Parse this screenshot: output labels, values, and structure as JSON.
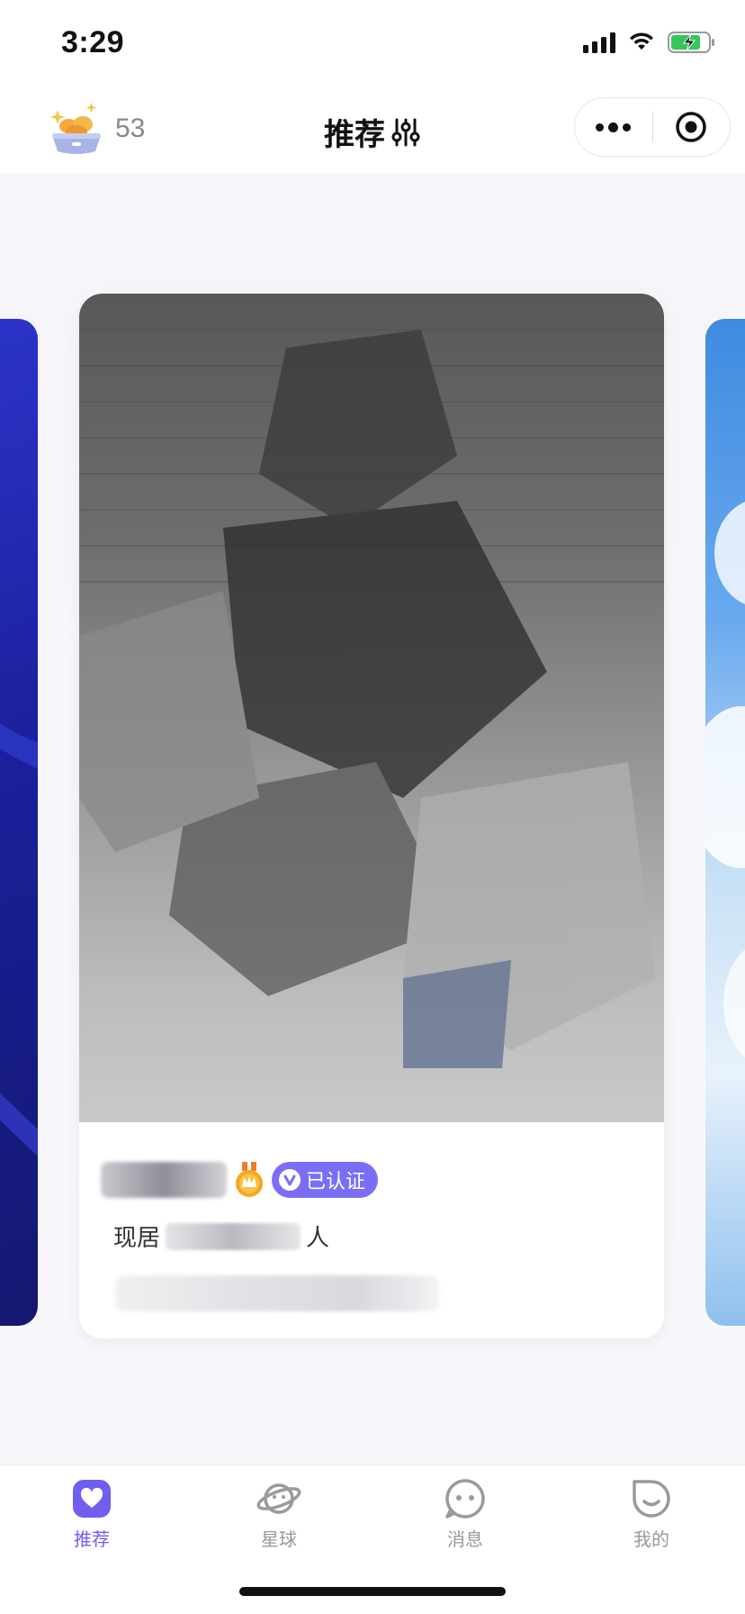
{
  "status_bar": {
    "time": "3:29",
    "battery_color": "#34c759"
  },
  "nav_bar": {
    "coin_count": "53",
    "title": "推荐",
    "filter_icon": "sliders-icon",
    "more_icon": "more-dots-icon",
    "target_icon": "record-target-icon"
  },
  "card": {
    "verified_label": "已认证",
    "location_prefix": "现居",
    "location_suffix": "人",
    "photo_state": "blurred",
    "accent_color": "#7b6ef6"
  },
  "tabs": [
    {
      "label": "推荐",
      "icon": "heart-icon",
      "active": true
    },
    {
      "label": "星球",
      "icon": "planet-icon",
      "active": false
    },
    {
      "label": "消息",
      "icon": "message-face-icon",
      "active": false
    },
    {
      "label": "我的",
      "icon": "smile-face-icon",
      "active": false
    }
  ]
}
